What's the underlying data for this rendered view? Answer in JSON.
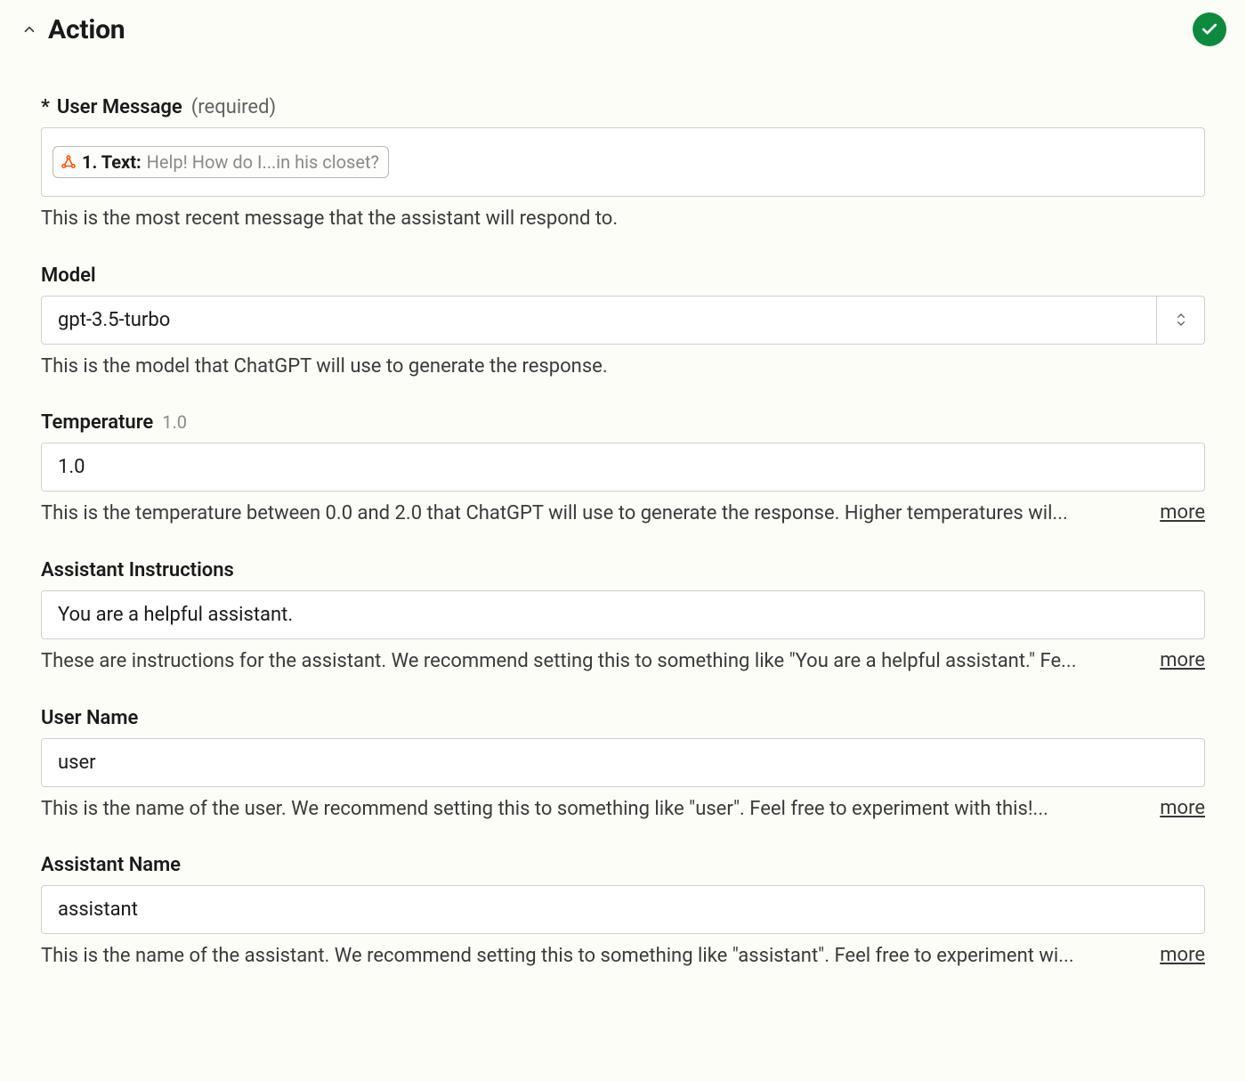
{
  "header": {
    "title": "Action",
    "status": "success"
  },
  "fields": {
    "userMessage": {
      "label": "User Message",
      "requiredHint": "(required)",
      "required": true,
      "pillLabel": "1. Text:",
      "pillText": "Help! How do I...in his closet?",
      "description": "This is the most recent message that the assistant will respond to."
    },
    "model": {
      "label": "Model",
      "value": "gpt-3.5-turbo",
      "description": "This is the model that ChatGPT will use to generate the response."
    },
    "temperature": {
      "label": "Temperature",
      "annotation": "1.0",
      "value": "1.0",
      "description": "This is the temperature between 0.0 and 2.0 that ChatGPT will use to generate the response. Higher temperatures wil...",
      "more": "more"
    },
    "assistantInstructions": {
      "label": "Assistant Instructions",
      "value": "You are a helpful assistant.",
      "description": "These are instructions for the assistant. We recommend setting this to something like \"You are a helpful assistant.\" Fe...",
      "more": "more"
    },
    "userName": {
      "label": "User Name",
      "value": "user",
      "description": "This is the name of the user. We recommend setting this to something like \"user\". Feel free to experiment with this!...",
      "more": "more"
    },
    "assistantName": {
      "label": "Assistant Name",
      "value": "assistant",
      "description": "This is the name of the assistant. We recommend setting this to something like \"assistant\". Feel free to experiment wi...",
      "more": "more"
    }
  }
}
